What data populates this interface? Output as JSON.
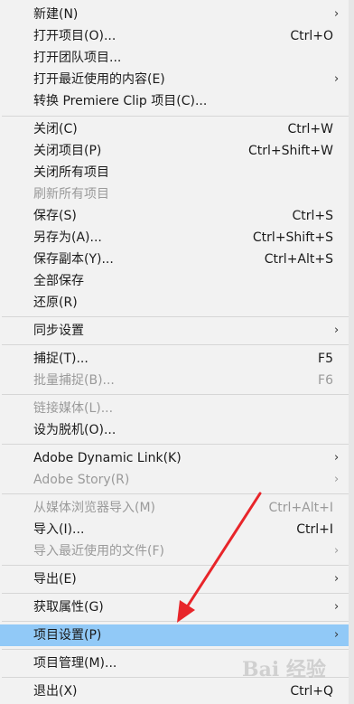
{
  "menu": {
    "items": [
      {
        "label": "新建(N)",
        "shortcut": "",
        "submenu": true
      },
      {
        "label": "打开项目(O)...",
        "shortcut": "Ctrl+O"
      },
      {
        "label": "打开团队项目...",
        "shortcut": ""
      },
      {
        "label": "打开最近使用的内容(E)",
        "shortcut": "",
        "submenu": true
      },
      {
        "label": "转换 Premiere Clip 项目(C)...",
        "shortcut": ""
      },
      {
        "label": "关闭(C)",
        "shortcut": "Ctrl+W"
      },
      {
        "label": "关闭项目(P)",
        "shortcut": "Ctrl+Shift+W"
      },
      {
        "label": "关闭所有项目",
        "shortcut": ""
      },
      {
        "label": "刷新所有项目",
        "shortcut": "",
        "disabled": true
      },
      {
        "label": "保存(S)",
        "shortcut": "Ctrl+S"
      },
      {
        "label": "另存为(A)...",
        "shortcut": "Ctrl+Shift+S"
      },
      {
        "label": "保存副本(Y)...",
        "shortcut": "Ctrl+Alt+S"
      },
      {
        "label": "全部保存",
        "shortcut": ""
      },
      {
        "label": "还原(R)",
        "shortcut": ""
      },
      {
        "label": "同步设置",
        "shortcut": "",
        "submenu": true
      },
      {
        "label": "捕捉(T)...",
        "shortcut": "F5"
      },
      {
        "label": "批量捕捉(B)...",
        "shortcut": "F6",
        "disabled": true
      },
      {
        "label": "链接媒体(L)...",
        "shortcut": "",
        "disabled": true
      },
      {
        "label": "设为脱机(O)...",
        "shortcut": ""
      },
      {
        "label": "Adobe Dynamic Link(K)",
        "shortcut": "",
        "submenu": true
      },
      {
        "label": "Adobe Story(R)",
        "shortcut": "",
        "submenu": true,
        "disabled": true
      },
      {
        "label": "从媒体浏览器导入(M)",
        "shortcut": "Ctrl+Alt+I",
        "disabled": true
      },
      {
        "label": "导入(I)...",
        "shortcut": "Ctrl+I"
      },
      {
        "label": "导入最近使用的文件(F)",
        "shortcut": "",
        "submenu": true,
        "disabled": true
      },
      {
        "label": "导出(E)",
        "shortcut": "",
        "submenu": true
      },
      {
        "label": "获取属性(G)",
        "shortcut": "",
        "submenu": true
      },
      {
        "label": "项目设置(P)",
        "shortcut": "",
        "submenu": true,
        "highlighted": true
      },
      {
        "label": "项目管理(M)...",
        "shortcut": ""
      },
      {
        "label": "退出(X)",
        "shortcut": "Ctrl+Q"
      }
    ],
    "submenu_glyph": "›"
  },
  "annotation": {
    "arrow_color": "#e8252a"
  },
  "watermark": {
    "text": "Bai 经验"
  }
}
